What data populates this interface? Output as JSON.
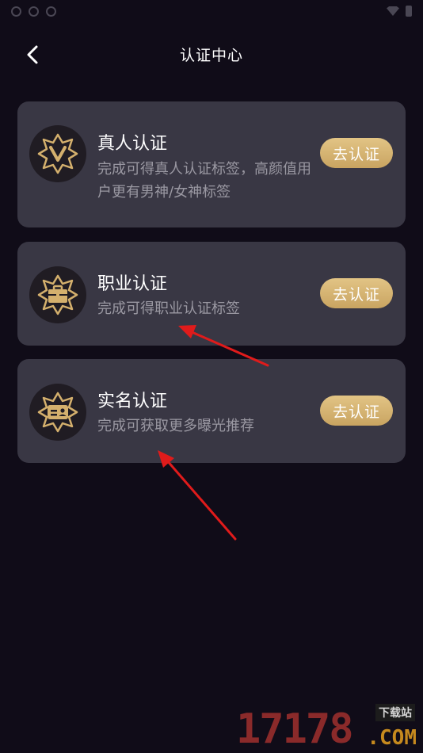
{
  "header": {
    "title": "认证中心",
    "back_icon": "chevron-left-icon"
  },
  "colors": {
    "background": "#100c18",
    "card": "#393744",
    "gold": "#d4b06d",
    "button_gold": "#c9a461",
    "desc_gray": "#9a98a2",
    "arrow_red": "#e01b1b"
  },
  "cards": [
    {
      "title": "真人认证",
      "description": "完成可得真人认证标签，高颜值用户更有男神/女神标签",
      "button_label": "去认证",
      "icon": "verified-v-icon"
    },
    {
      "title": "职业认证",
      "description": "完成可得职业认证标签",
      "button_label": "去认证",
      "icon": "briefcase-icon"
    },
    {
      "title": "实名认证",
      "description": "完成可获取更多曝光推荐",
      "button_label": "去认证",
      "icon": "id-card-icon"
    }
  ],
  "watermark": {
    "digits": "17178",
    "site": "下载站",
    "domain": ".COM"
  }
}
